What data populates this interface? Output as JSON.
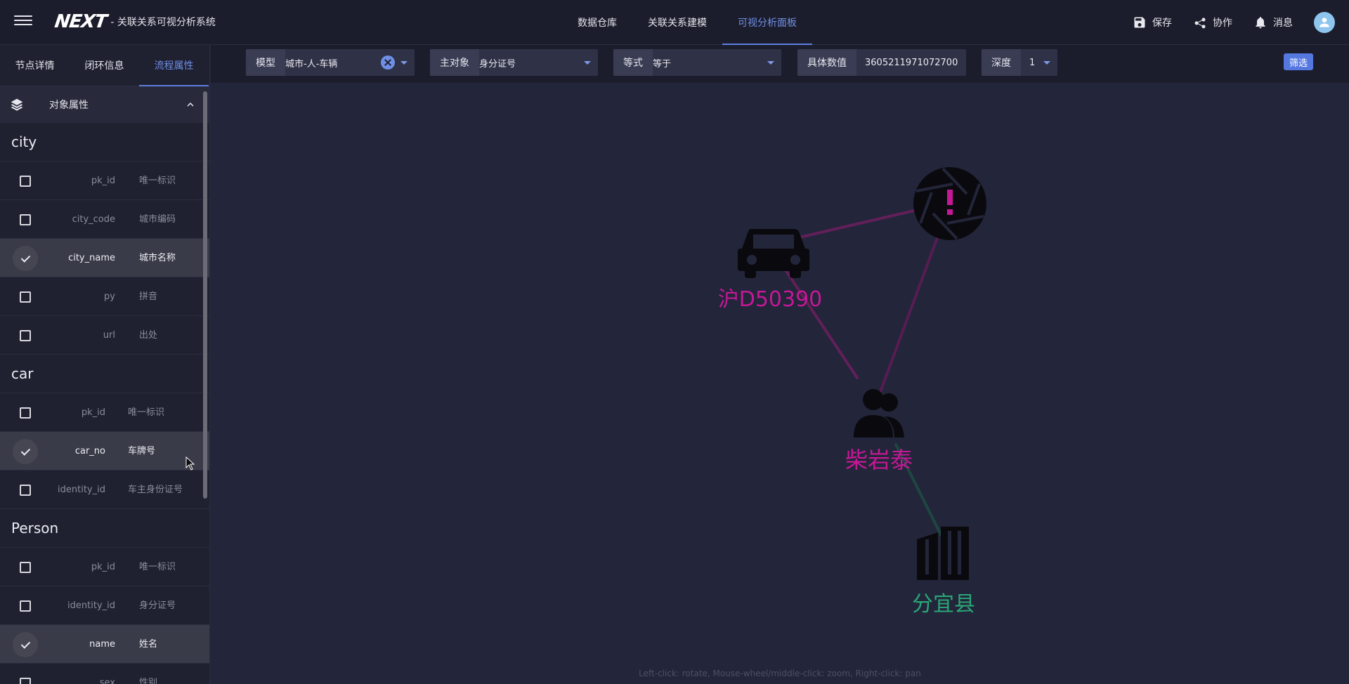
{
  "header": {
    "logo_text": "NEXT",
    "app_subtitle": "- 关联关系可视分析系统",
    "nav": [
      {
        "label": "数据仓库",
        "active": false
      },
      {
        "label": "关联关系建模",
        "active": false
      },
      {
        "label": "可视分析面板",
        "active": true
      }
    ],
    "actions": {
      "save": "保存",
      "collab": "协作",
      "messages": "消息"
    }
  },
  "sidebar": {
    "tabs": [
      {
        "label": "节点详情",
        "active": false
      },
      {
        "label": "闭环信息",
        "active": false
      },
      {
        "label": "流程属性",
        "active": true
      }
    ],
    "section_title": "对象属性",
    "groups": [
      {
        "name": "city",
        "fields": [
          {
            "key": "pk_id",
            "label": "唯一标识",
            "checked": false
          },
          {
            "key": "city_code",
            "label": "城市编码",
            "checked": false
          },
          {
            "key": "city_name",
            "label": "城市名称",
            "checked": true
          },
          {
            "key": "py",
            "label": "拼音",
            "checked": false
          },
          {
            "key": "url",
            "label": "出处",
            "checked": false
          }
        ]
      },
      {
        "name": "car",
        "fields": [
          {
            "key": "pk_id",
            "label": "唯一标识",
            "checked": false
          },
          {
            "key": "car_no",
            "label": "车牌号",
            "checked": true
          },
          {
            "key": "identity_id",
            "label": "车主身份证号",
            "checked": false
          }
        ]
      },
      {
        "name": "Person",
        "fields": [
          {
            "key": "pk_id",
            "label": "唯一标识",
            "checked": false
          },
          {
            "key": "identity_id",
            "label": "身分证号",
            "checked": false
          },
          {
            "key": "name",
            "label": "姓名",
            "checked": true
          },
          {
            "key": "sex",
            "label": "性别",
            "checked": false
          }
        ]
      }
    ]
  },
  "filters": {
    "model": {
      "label": "模型",
      "value": "城市-人-车辆"
    },
    "subject": {
      "label": "主对象",
      "value": "身分证号"
    },
    "operator": {
      "label": "等式",
      "value": "等于"
    },
    "value": {
      "label": "具体数值",
      "value": "3605211971072700"
    },
    "depth": {
      "label": "深度",
      "value": "1"
    },
    "filter_button": "筛选"
  },
  "graph": {
    "nodes": [
      {
        "id": "car",
        "label": "沪D50390",
        "icon": "car-icon",
        "color": "#c41896"
      },
      {
        "id": "alert",
        "label": "",
        "icon": "camera-shutter-alert-icon",
        "color": "#c41896"
      },
      {
        "id": "person",
        "label": "柴岩泰",
        "icon": "people-icon",
        "color": "#c41896"
      },
      {
        "id": "city",
        "label": "分宜县",
        "icon": "building-icon",
        "color": "#2aa777"
      }
    ],
    "edge_colors": {
      "pink": "#7a2068",
      "green": "#1f5a49"
    },
    "hint": "Left-click: rotate, Mouse-wheel/middle-click: zoom, Right-click: pan"
  },
  "colors": {
    "accent": "#6f8fe6",
    "background": "#23253a",
    "panel": "#1f2030"
  }
}
